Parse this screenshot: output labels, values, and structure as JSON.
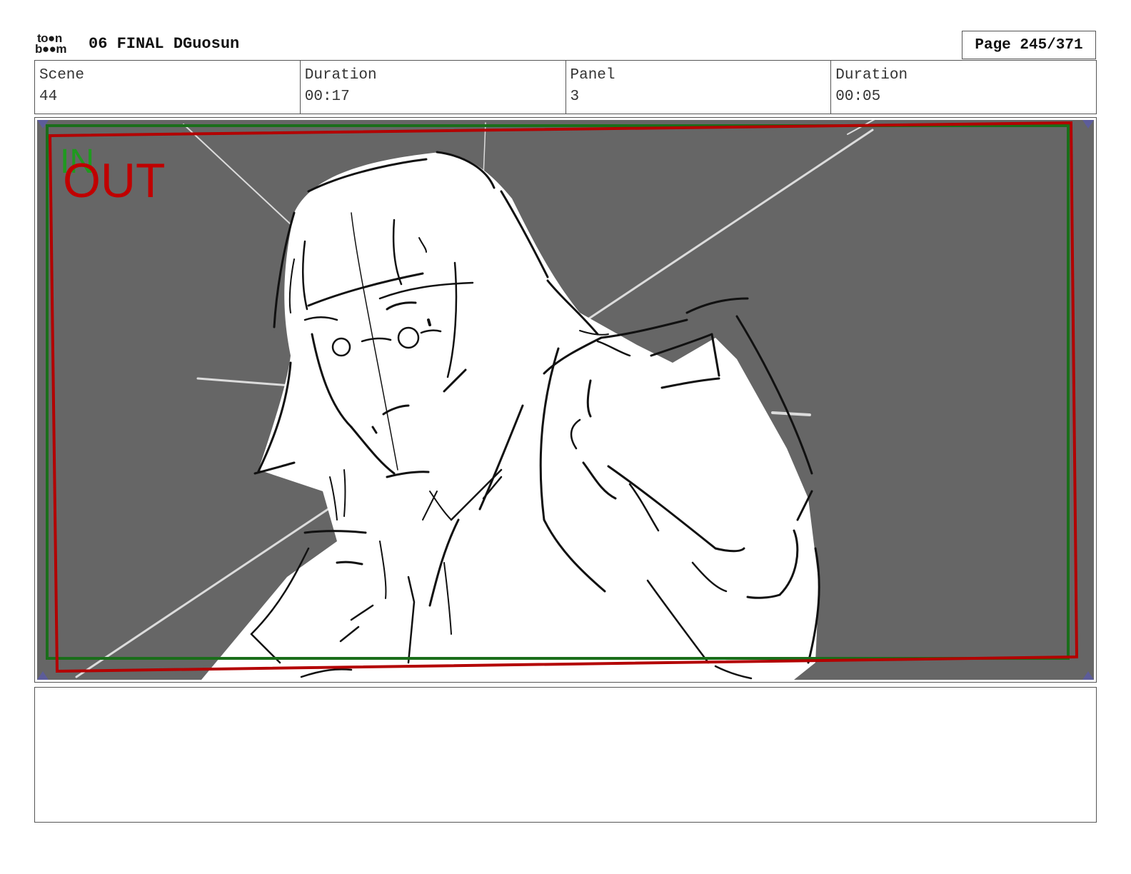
{
  "header": {
    "logo_top": "to●n",
    "logo_bottom": "b●●m",
    "title": "06 FINAL DGuosun",
    "page": "Page 245/371"
  },
  "info": [
    {
      "label": "Scene",
      "value": "44"
    },
    {
      "label": "Duration",
      "value": "00:17"
    },
    {
      "label": "Panel",
      "value": "3"
    },
    {
      "label": "Duration",
      "value": "00:05"
    }
  ],
  "panel": {
    "in_label": "IN",
    "out_label": "OUT",
    "in_color": "#1f9a1f",
    "out_color": "#c00000",
    "background_color": "#666666"
  },
  "notes": ""
}
